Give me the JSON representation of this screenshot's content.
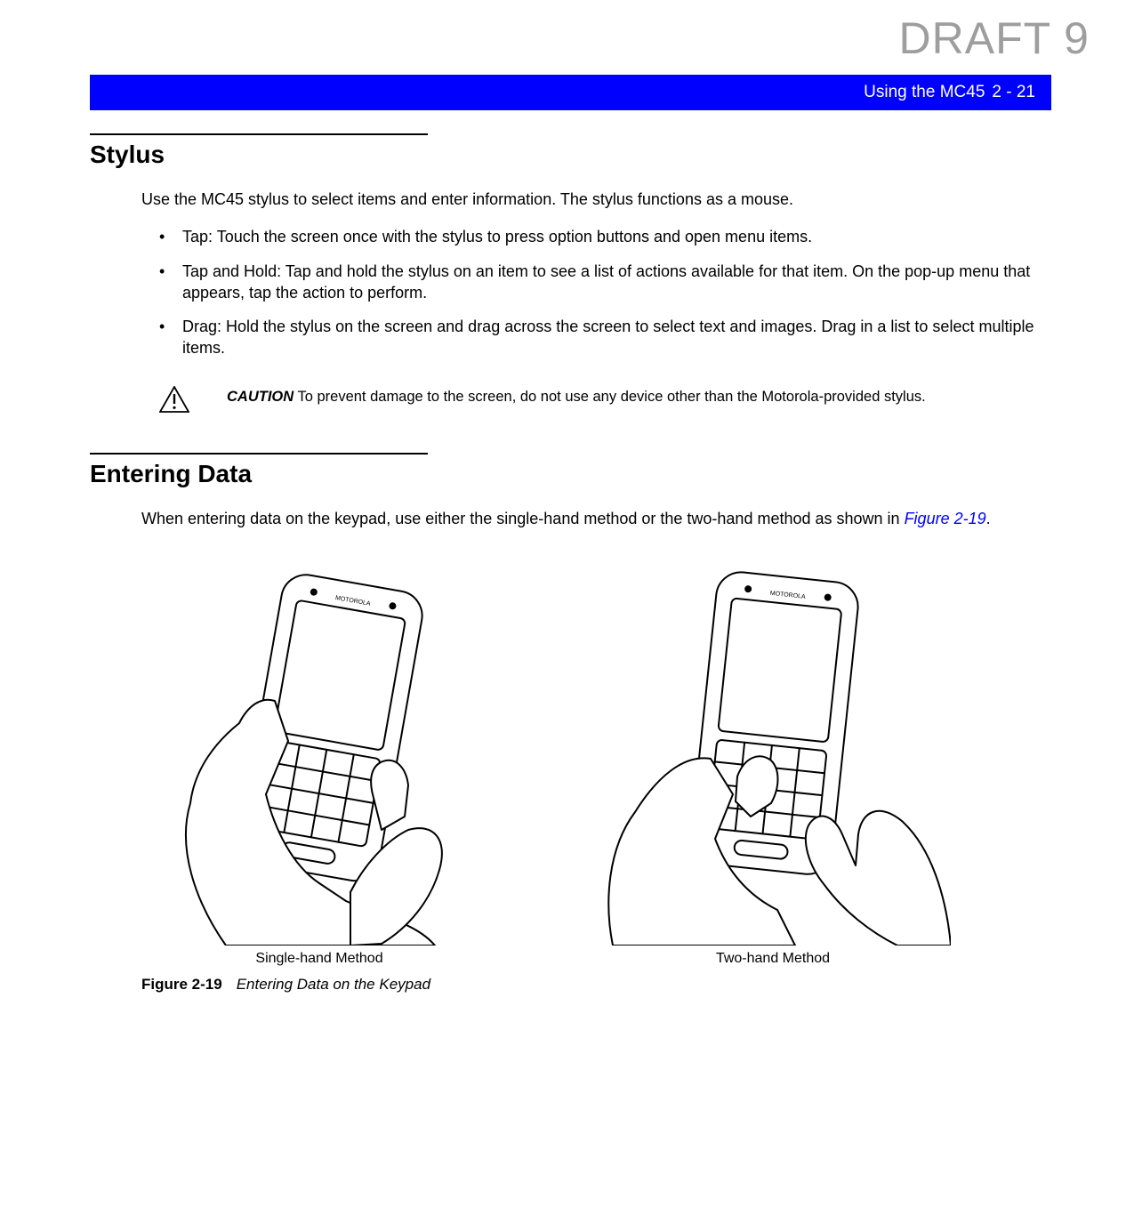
{
  "watermark": "DRAFT 9",
  "header": {
    "title": "Using the MC45",
    "page": "2 - 21"
  },
  "section1": {
    "title": "Stylus",
    "intro": "Use the MC45 stylus to select items and enter information. The stylus functions as a mouse.",
    "bullets": [
      "Tap: Touch the screen once with the stylus to press option buttons and open menu items.",
      "Tap and Hold: Tap and hold the stylus on an item to see a list of actions available for that item. On the pop-up menu that appears, tap the action to perform.",
      "Drag: Hold the stylus on the screen and drag across the screen to select text and images. Drag in a list to select multiple items."
    ]
  },
  "caution": {
    "label": "CAUTION",
    "text": " To prevent damage to the screen, do not use any device other than the Motorola-provided stylus."
  },
  "section2": {
    "title": "Entering Data",
    "intro_pre": "When entering data on the keypad, use either the single-hand method or the two-hand method as shown in ",
    "xref": "Figure 2-19",
    "intro_post": "."
  },
  "figure": {
    "left_label": "Single-hand Method",
    "right_label": "Two-hand Method",
    "caption_num": "Figure 2-19",
    "caption_title": "Entering Data on the Keypad"
  }
}
